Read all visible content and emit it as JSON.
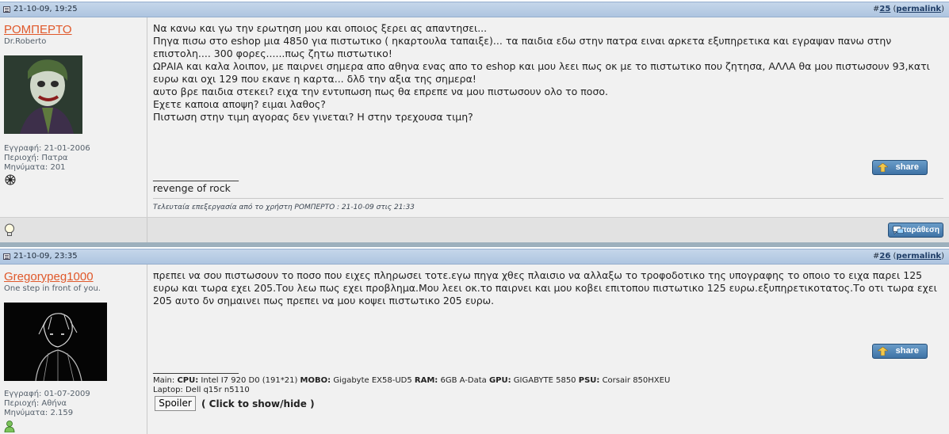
{
  "posts": [
    {
      "date": "21-10-09, 19:25",
      "number_prefix": "#",
      "number": "25",
      "permalink": "permalink",
      "author": {
        "username": "ΡΟΜΠΕΡΤΟ",
        "title": "Dr.Roberto",
        "registration": "Εγγραφή: 21-01-2006",
        "location": "Περιοχή: Πατρα",
        "posts": "Μηνύματα: 201"
      },
      "message": [
        "Να κανω και γω την ερωτηση μου και οποιος ξερει ας απαντησει...",
        "Πηγα πισω στο eshop μια 4850 για πιστωτικο ( ηκαρτουλα ταπαιξε)... τα παιδια εδω στην πατρα ειναι αρκετα εξυπηρετικα και εγραψαν πανω στην επιστολη.... 300 φορες......πως ζητω πιστωτικο!",
        "ΩΡΑΙΑ και καλα λοιπον, με παιρνει σημερα απο αθηνα ενας απο το eshop και μου λεει πως οκ με το πιστωτικο που ζητησα, ΑΛΛΑ θα μου πιστωσουν 93,κατι ευρω και οχι 129 που εκανε η καρτα... δλδ την αξια της σημερα!",
        "αυτο βρε παιδια στεκει? ειχα την εντυπωση πως θα επρεπε να μου πιστωσουν ολο το ποσο.",
        "Εχετε καποια αποψη? ειμαι λαθος?",
        "Πιστωση στην τιμη αγορας δεν γινεται? Η στην τρεχουσα τιμη?"
      ],
      "signature_line": "__________________",
      "signature": "revenge of rock",
      "share_label": "share",
      "edit_note": "Τελευταία επεξεργασία από το χρήστη ΡΟΜΠΕΡΤΟ : 21-10-09 στις",
      "edit_time": "21:33",
      "quote_label": "παράθεση"
    },
    {
      "date": "21-10-09, 23:35",
      "number_prefix": "#",
      "number": "26",
      "permalink": "permalink",
      "author": {
        "username": "Gregorypeg1000",
        "title": "One step in front of you.",
        "registration": "Εγγραφή: 01-07-2009",
        "location": "Περιοχή: Αθήνα",
        "posts": "Μηνύματα: 2.159"
      },
      "message": [
        "πρεπει να σου πιστωσουν το ποσο που ειχες πληρωσει τοτε.εγω πηγα χθες πλαισιο να αλλαξω το τροφοδοτικο της υπογραφης το οποιο το ειχα παρει 125 ευρω και τωρα εχει 205.Του λεω πως εχει προβλημα.Μου λεει οκ.το παιρνει και μου κοβει επιτοπου πιστωτικο 125 ευρω.εξυπηρετικοτατος.Το οτι τωρα εχει 205 αυτο δν σημαινει πως πρεπει να μου κοψει πιστωτικο 205 ευρω."
      ],
      "signature_line": "__________________",
      "share_label": "share",
      "specs": {
        "main_prefix": "Main:",
        "cpu_label": "CPU:",
        "cpu": "Intel I7 920 D0 (191*21)",
        "mobo_label": "MOBO:",
        "mobo": "Gigabyte EX58-UD5",
        "ram_label": "RAM:",
        "ram": "6GB A-Data",
        "gpu_label": "GPU:",
        "gpu": "GIGABYTE 5850",
        "psu_label": "PSU:",
        "psu": "Corsair 850HXEU",
        "laptop": "Laptop: Dell q15r n5110"
      },
      "spoiler_label": "Spoiler",
      "spoiler_hint": "( Click to show/hide )"
    }
  ],
  "colors": {
    "header_bg": "#b9cde6",
    "username": "#e0582a",
    "post_bg": "#f1f1f1",
    "button": "#4a7fb2"
  }
}
